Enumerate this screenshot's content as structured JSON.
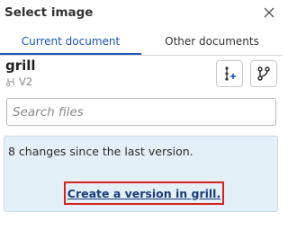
{
  "dialog": {
    "title": "Select image",
    "close_icon": "close-icon"
  },
  "tabs": [
    {
      "label": "Current document",
      "active": true
    },
    {
      "label": "Other documents",
      "active": false
    }
  ],
  "document": {
    "name": "grill",
    "version": "V2"
  },
  "toolbar": {
    "insert_version_icon": "insert-version-icon",
    "branch_icon": "branch-icon"
  },
  "search": {
    "placeholder": "Search files",
    "value": ""
  },
  "info": {
    "message": "8 changes since the last version.",
    "link_label": "Create a version in grill."
  },
  "colors": {
    "accent": "#1a55b8",
    "info_bg": "#e4f0f8",
    "highlight": "#d7201f"
  }
}
